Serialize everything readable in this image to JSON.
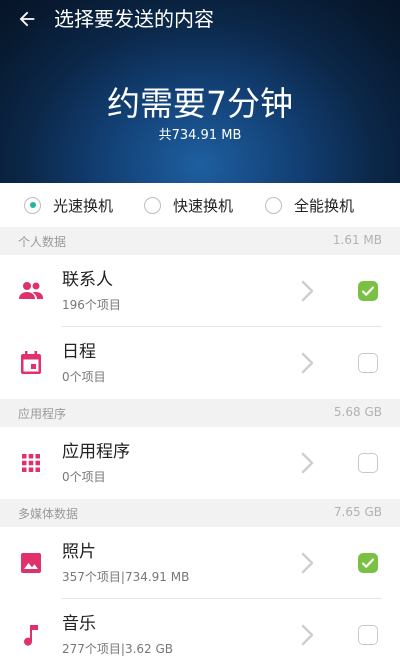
{
  "header": {
    "title": "选择要发送的内容",
    "estimate": "约需要7分钟",
    "total": "共734.91 MB"
  },
  "modes": [
    {
      "label": "光速换机",
      "selected": true
    },
    {
      "label": "快速换机",
      "selected": false
    },
    {
      "label": "全能换机",
      "selected": false
    }
  ],
  "sections": [
    {
      "title": "个人数据",
      "size": "1.61 MB",
      "items": [
        {
          "name": "联系人",
          "sub": "196个项目",
          "checked": true,
          "icon": "contacts-icon"
        },
        {
          "name": "日程",
          "sub": "0个项目",
          "checked": false,
          "icon": "calendar-icon"
        }
      ]
    },
    {
      "title": "应用程序",
      "size": "5.68 GB",
      "items": [
        {
          "name": "应用程序",
          "sub": "0个项目",
          "checked": false,
          "icon": "apps-grid-icon"
        }
      ]
    },
    {
      "title": "多媒体数据",
      "size": "7.65 GB",
      "items": [
        {
          "name": "照片",
          "sub": "357个项目|734.91 MB",
          "checked": true,
          "icon": "photo-icon"
        },
        {
          "name": "音乐",
          "sub": "277个项目|3.62 GB",
          "checked": false,
          "icon": "music-icon"
        }
      ]
    }
  ],
  "colors": {
    "accent": "#e0306e",
    "check_on": "#7ac143",
    "radio_selected": "#1fb89a"
  }
}
